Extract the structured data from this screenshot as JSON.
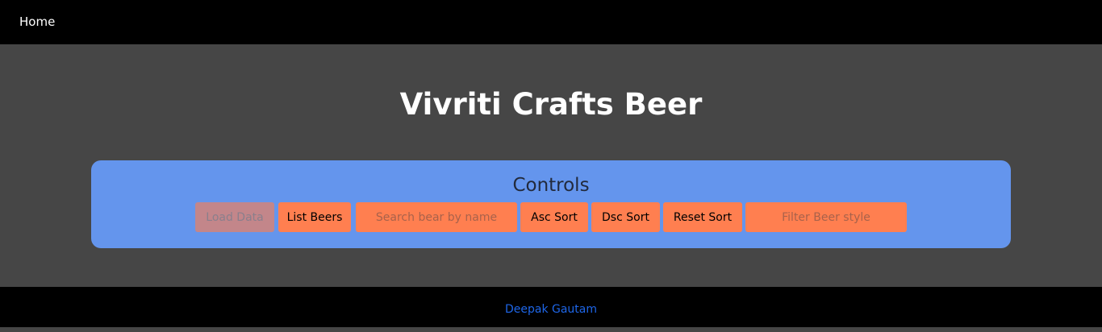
{
  "nav": {
    "home_label": "Home"
  },
  "page": {
    "title": "Vivriti Crafts Beer"
  },
  "controls": {
    "title": "Controls",
    "load_data_label": "Load Data",
    "list_beers_label": "List Beers",
    "search_placeholder": "Search bear by name",
    "search_value": "",
    "asc_sort_label": "Asc Sort",
    "dsc_sort_label": "Dsc Sort",
    "reset_sort_label": "Reset Sort",
    "filter_placeholder": "Filter Beer style",
    "filter_value": ""
  },
  "footer": {
    "author_label": "Deepak Gautam"
  },
  "colors": {
    "navbar": "#000000",
    "background": "#464646",
    "panel": "#6495ed",
    "button": "#ff7f50",
    "button_disabled": "#c3868a",
    "footer_link": "#1e66e8"
  }
}
